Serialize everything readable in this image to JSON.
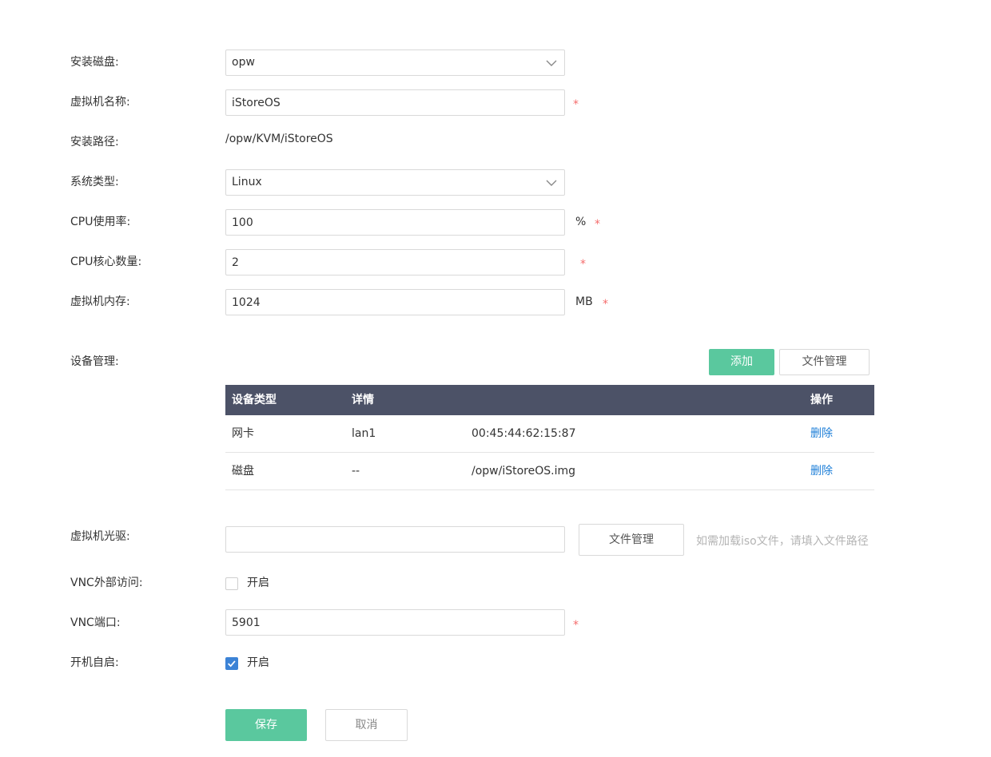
{
  "form": {
    "install_disk": {
      "label": "安装磁盘:",
      "value": "opw"
    },
    "vm_name": {
      "label": "虚拟机名称:",
      "value": "iStoreOS",
      "required": "*"
    },
    "install_path": {
      "label": "安装路径:",
      "value": "/opw/KVM/iStoreOS"
    },
    "os_type": {
      "label": "系统类型:",
      "value": "Linux"
    },
    "cpu_usage": {
      "label": "CPU使用率:",
      "value": "100",
      "unit": "%",
      "required": "*"
    },
    "cpu_cores": {
      "label": "CPU核心数量:",
      "value": "2",
      "required": "*"
    },
    "vm_memory": {
      "label": "虚拟机内存:",
      "value": "1024",
      "unit": "MB",
      "required": "*"
    },
    "device_mgmt": {
      "label": "设备管理:",
      "add_button": "添加",
      "file_mgmt_button": "文件管理",
      "columns": [
        "设备类型",
        "详情",
        "",
        "操作"
      ],
      "rows": [
        {
          "type": "网卡",
          "detail": "lan1",
          "extra": "00:45:44:62:15:87",
          "action": "删除"
        },
        {
          "type": "磁盘",
          "detail": "--",
          "extra": "/opw/iStoreOS.img",
          "action": "删除"
        }
      ]
    },
    "cdrom": {
      "label": "虚拟机光驱:",
      "value": "",
      "file_mgmt_button": "文件管理",
      "hint": "如需加载iso文件，请填入文件路径"
    },
    "vnc_external": {
      "label": "VNC外部访问:",
      "option": "开启",
      "checked": false
    },
    "vnc_port": {
      "label": "VNC端口:",
      "value": "5901",
      "required": "*"
    },
    "autostart": {
      "label": "开机自启:",
      "option": "开启",
      "checked": true
    }
  },
  "actions": {
    "save": "保存",
    "cancel": "取消"
  },
  "colors": {
    "accent": "#5ac89e",
    "table_header": "#4c5267",
    "link": "#1e7fd8",
    "required": "#f56c6c",
    "checkbox": "#3c83d6"
  }
}
